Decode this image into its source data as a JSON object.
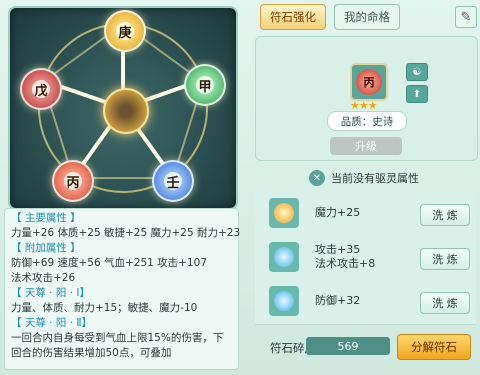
{
  "tabs": [
    {
      "label": "符石强化"
    },
    {
      "label": "我的命格"
    }
  ],
  "wheel": {
    "gems": [
      "庚",
      "甲",
      "壬",
      "丙",
      "戊"
    ],
    "center_icon": "taiji-emblem-icon"
  },
  "attrs": {
    "main_header": "【 主要属性 】",
    "main_line": "力量+26 体质+25 敏捷+25 魔力+25 耐力+23",
    "extra_header": "【 附加属性 】",
    "extra_line1": "防御+69 速度+56 气血+251 攻击+107",
    "extra_line2": "法术攻击+26",
    "tianzun1_header": "【 天尊 · 阳 · Ⅰ】",
    "tianzun1_line": "力量、体质、耐力+15；敏捷、魔力-10",
    "tianzun2_header": "【 天尊 · 阳 · Ⅱ】",
    "tianzun2_line": "一回合内自身每受到气血上限15%的伤害，下回合的伤害结果增加50点，可叠加"
  },
  "rune": {
    "char": "丙",
    "stars": "★★★",
    "quality": "品质：史诗",
    "upgrade_label": "升级"
  },
  "notice": "当前没有驱灵属性",
  "slots": [
    {
      "lines": [
        "魔力+25"
      ],
      "wash": "洗 炼",
      "color": "#f2a12a"
    },
    {
      "lines": [
        "攻击+35",
        "法术攻击+8"
      ],
      "wash": "洗 炼",
      "color": "#3fb2e6"
    },
    {
      "lines": [
        "防御+32"
      ],
      "wash": "洗 炼",
      "color": "#3fb2e6"
    }
  ],
  "fragments": {
    "label": "符石碎片",
    "value": "569",
    "button": "分解符石"
  }
}
